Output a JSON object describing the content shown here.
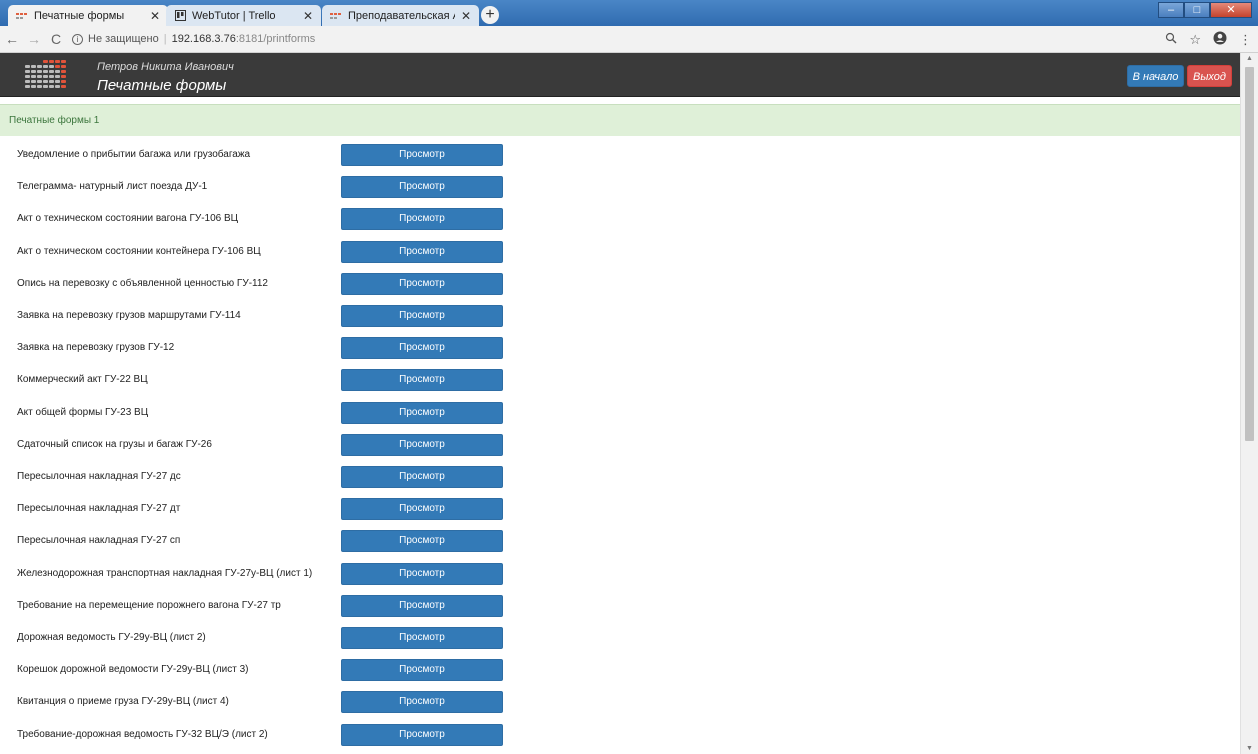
{
  "browser": {
    "tabs": [
      {
        "title": "Печатные формы",
        "icon": "app-favicon-icon",
        "active": true
      },
      {
        "title": "WebTutor | Trello",
        "icon": "trello-icon",
        "active": false
      },
      {
        "title": "Преподавательская АОСППД",
        "icon": "app-favicon-icon",
        "active": false
      }
    ],
    "new_tab_label": "+",
    "security_label": "Не защищено",
    "url_host": "192.168.3.76",
    "url_path": ":8181/printforms"
  },
  "header": {
    "user_name": "Петров Никита Иванович",
    "title": "Печатные формы",
    "home_label": "В начало",
    "exit_label": "Выход"
  },
  "section": {
    "title": "Печатные формы 1"
  },
  "view_label": "Просмотр",
  "forms": [
    "Уведомление о прибытии багажа или грузобагажа",
    "Телеграмма- натурный лист поезда ДУ-1",
    "Акт о техническом состоянии вагона ГУ-106 ВЦ",
    "Акт о техническом состоянии контейнера ГУ-106 ВЦ",
    "Опись на перевозку с объявленной ценностью ГУ-112",
    "Заявка на перевозку грузов маршрутами ГУ-114",
    "Заявка на перевозку грузов ГУ-12",
    "Коммерческий акт ГУ-22 ВЦ",
    "Акт общей формы ГУ-23 ВЦ",
    "Сдаточный список на грузы и багаж ГУ-26",
    "Пересылочная накладная ГУ-27 дс",
    "Пересылочная накладная ГУ-27 дт",
    "Пересылочная накладная ГУ-27 сп",
    "Железнодорожная транспортная накладная ГУ-27у-ВЦ (лист 1)",
    "Требование на перемещение порожнего вагона ГУ-27 тр",
    "Дорожная ведомость ГУ-29у-ВЦ (лист 2)",
    "Корешок дорожной ведомости ГУ-29у-ВЦ (лист 3)",
    "Квитанция о приеме груза ГУ-29у-ВЦ (лист 4)",
    "Требование-дорожная ведомость ГУ-32 ВЦ/Э (лист 2)"
  ],
  "colors": {
    "primary": "#337ab7",
    "danger": "#d9534f",
    "header_bg": "#3a3a3a",
    "section_bg": "#dff0d8",
    "section_text": "#3c763d"
  }
}
